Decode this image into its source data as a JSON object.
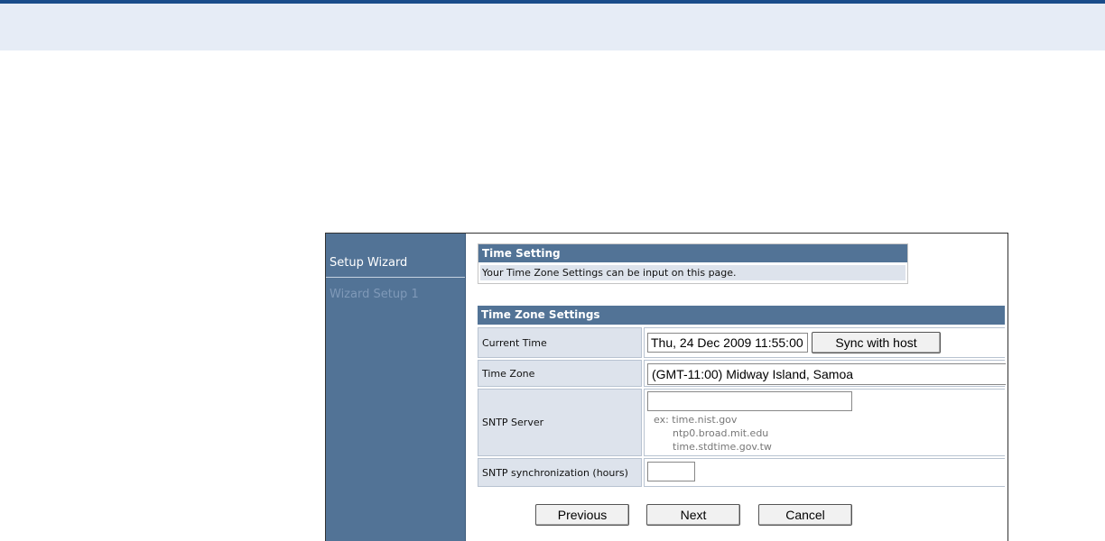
{
  "sidebar": {
    "title": "Setup Wizard",
    "items": [
      {
        "label": "Wizard Setup 1"
      }
    ]
  },
  "time_setting": {
    "header": "Time Setting",
    "description": "Your Time Zone Settings can be input on this page."
  },
  "tz_settings": {
    "header": "Time Zone Settings",
    "current_time": {
      "label": "Current Time",
      "value": "Thu, 24 Dec 2009 11:55:00",
      "sync_button": "Sync with host"
    },
    "time_zone": {
      "label": "Time Zone",
      "value": "(GMT-11:00) Midway Island, Samoa"
    },
    "sntp_server": {
      "label": "SNTP Server",
      "value": "",
      "examples": [
        "ex: time.nist.gov",
        "ntp0.broad.mit.edu",
        "time.stdtime.gov.tw"
      ]
    },
    "sntp_sync": {
      "label": "SNTP synchronization (hours)",
      "value": ""
    }
  },
  "buttons": {
    "previous": "Previous",
    "next": "Next",
    "cancel": "Cancel"
  },
  "colors": {
    "header_bg": "#527396",
    "label_bg": "#dde3ec",
    "top_band": "#e6ecf6"
  }
}
